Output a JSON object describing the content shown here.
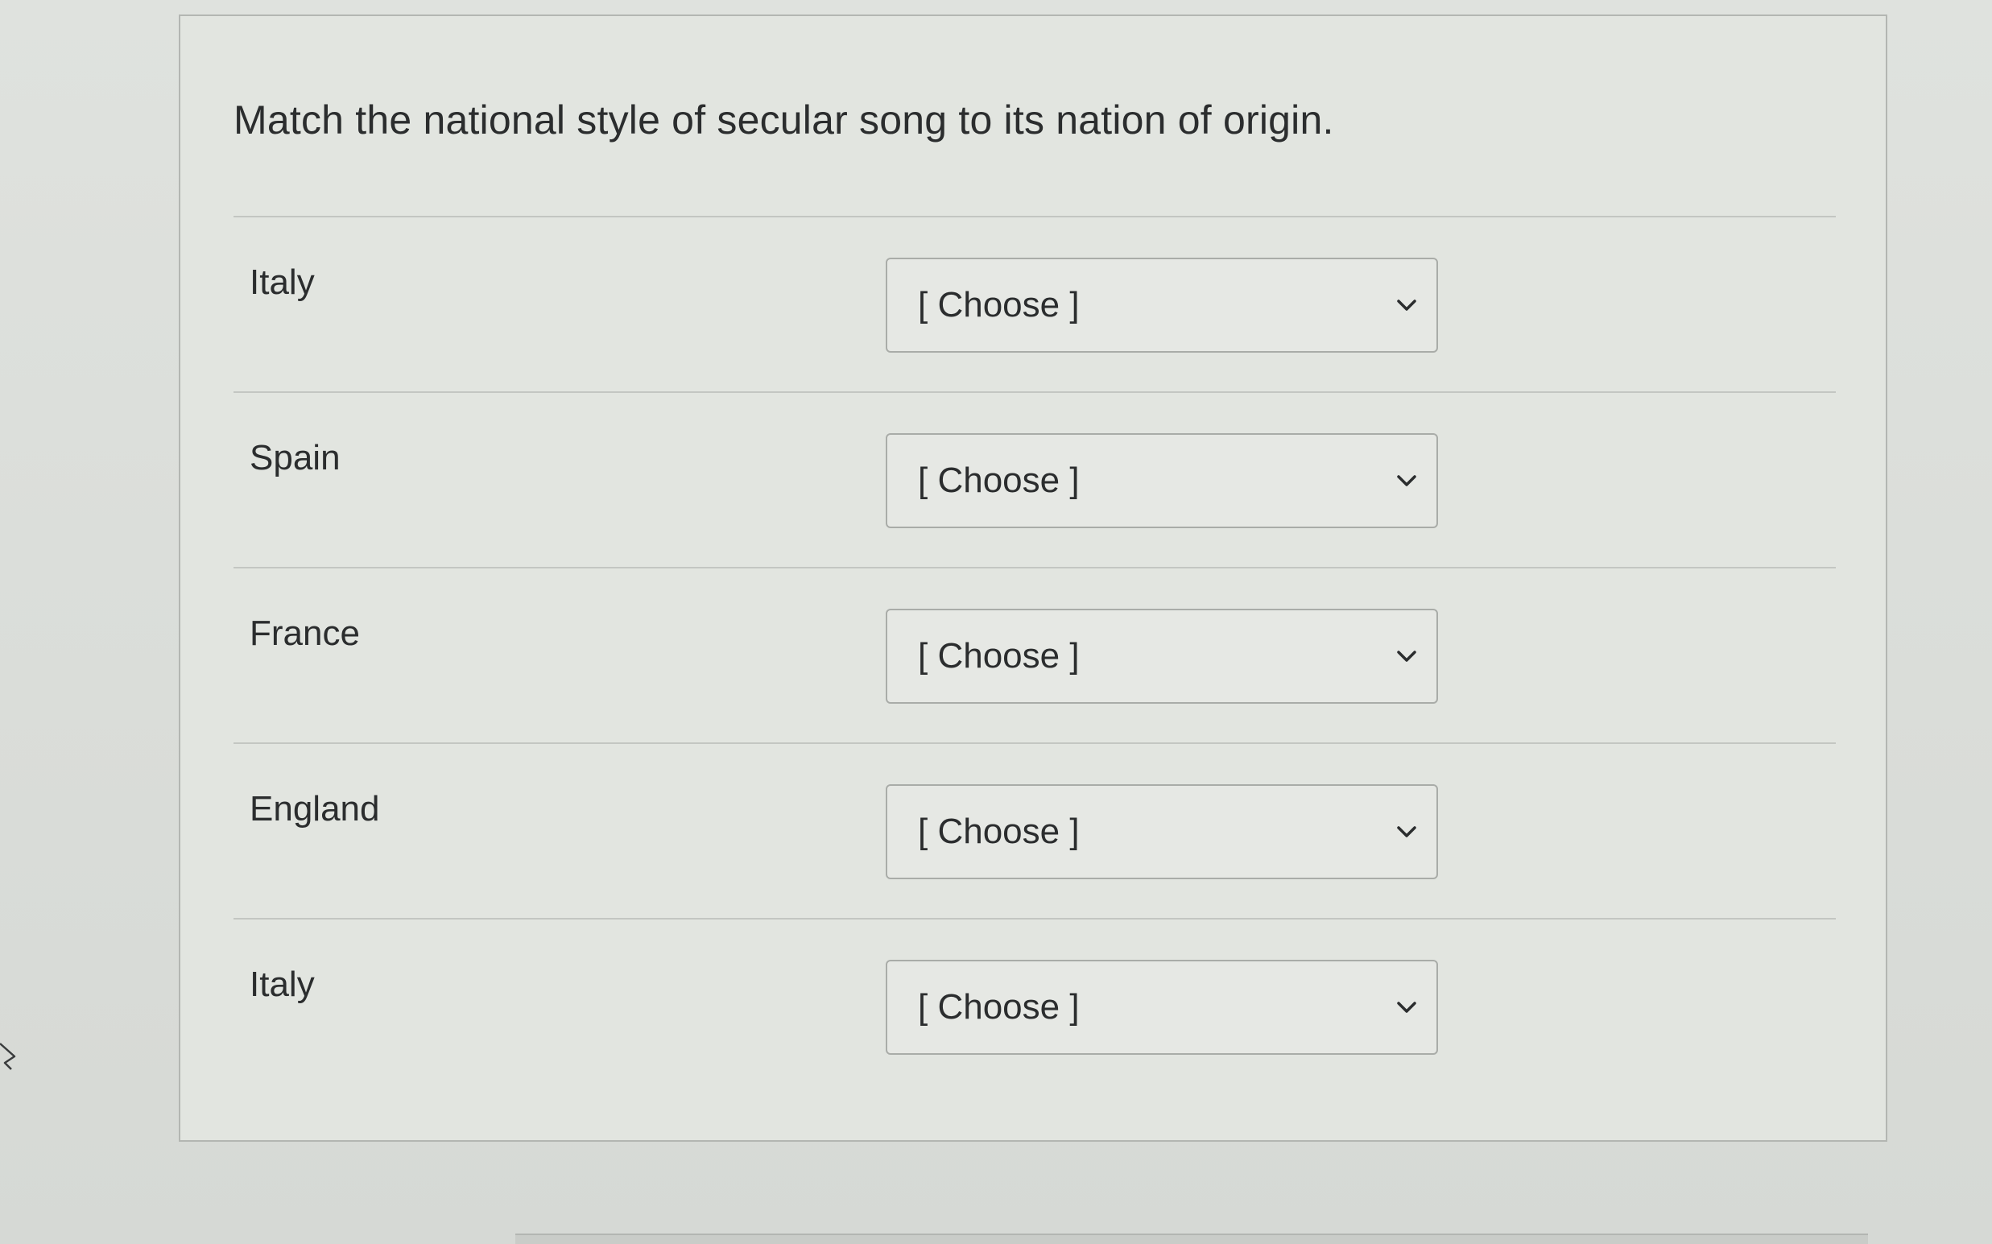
{
  "question": {
    "text": "Match the national style of secular song to its nation of origin."
  },
  "rows": [
    {
      "label": "Italy",
      "selected": "[ Choose ]"
    },
    {
      "label": "Spain",
      "selected": "[ Choose ]"
    },
    {
      "label": "France",
      "selected": "[ Choose ]"
    },
    {
      "label": "England",
      "selected": "[ Choose ]"
    },
    {
      "label": "Italy",
      "selected": "[ Choose ]"
    }
  ],
  "icons": {
    "dropdown": "chevron-down-icon",
    "pointer": "mouse-cursor-icon"
  },
  "colors": {
    "text": "#2b2d2e",
    "border": "#a9aca8",
    "card_background": "#e2e5e0"
  }
}
